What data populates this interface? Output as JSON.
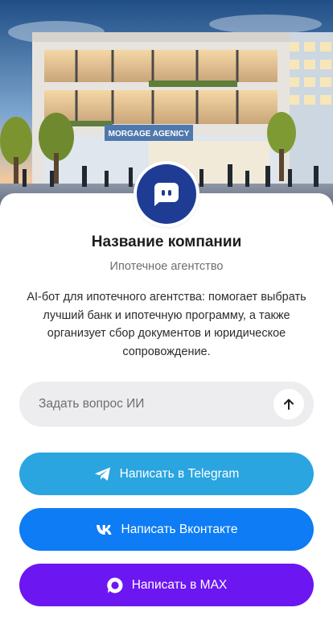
{
  "hero": {
    "sign_text": "MORGAGE AGENICY"
  },
  "profile": {
    "avatar_icon": "chat-bot-icon",
    "name": "Название компании",
    "subtitle": "Ипотечное агентство",
    "description": "AI-бот для ипотечного агентства: помогает выбрать лучший банк и ипотечную программу, а также организует сбор документов и юридическое сопровождение."
  },
  "ask": {
    "placeholder": "Задать вопрос ИИ",
    "value": "",
    "send_icon": "arrow-up-icon"
  },
  "buttons": {
    "telegram": {
      "label": "Написать в Telegram",
      "icon": "telegram-icon",
      "color": "#2aa5e0"
    },
    "vk": {
      "label": "Написать Вконтакте",
      "icon": "vk-icon",
      "color": "#0d7cf5"
    },
    "max": {
      "label": "Написать в MAX",
      "icon": "max-icon",
      "color": "#6c16f2"
    }
  },
  "colors": {
    "brand_dark_blue": "#1f3c94"
  }
}
